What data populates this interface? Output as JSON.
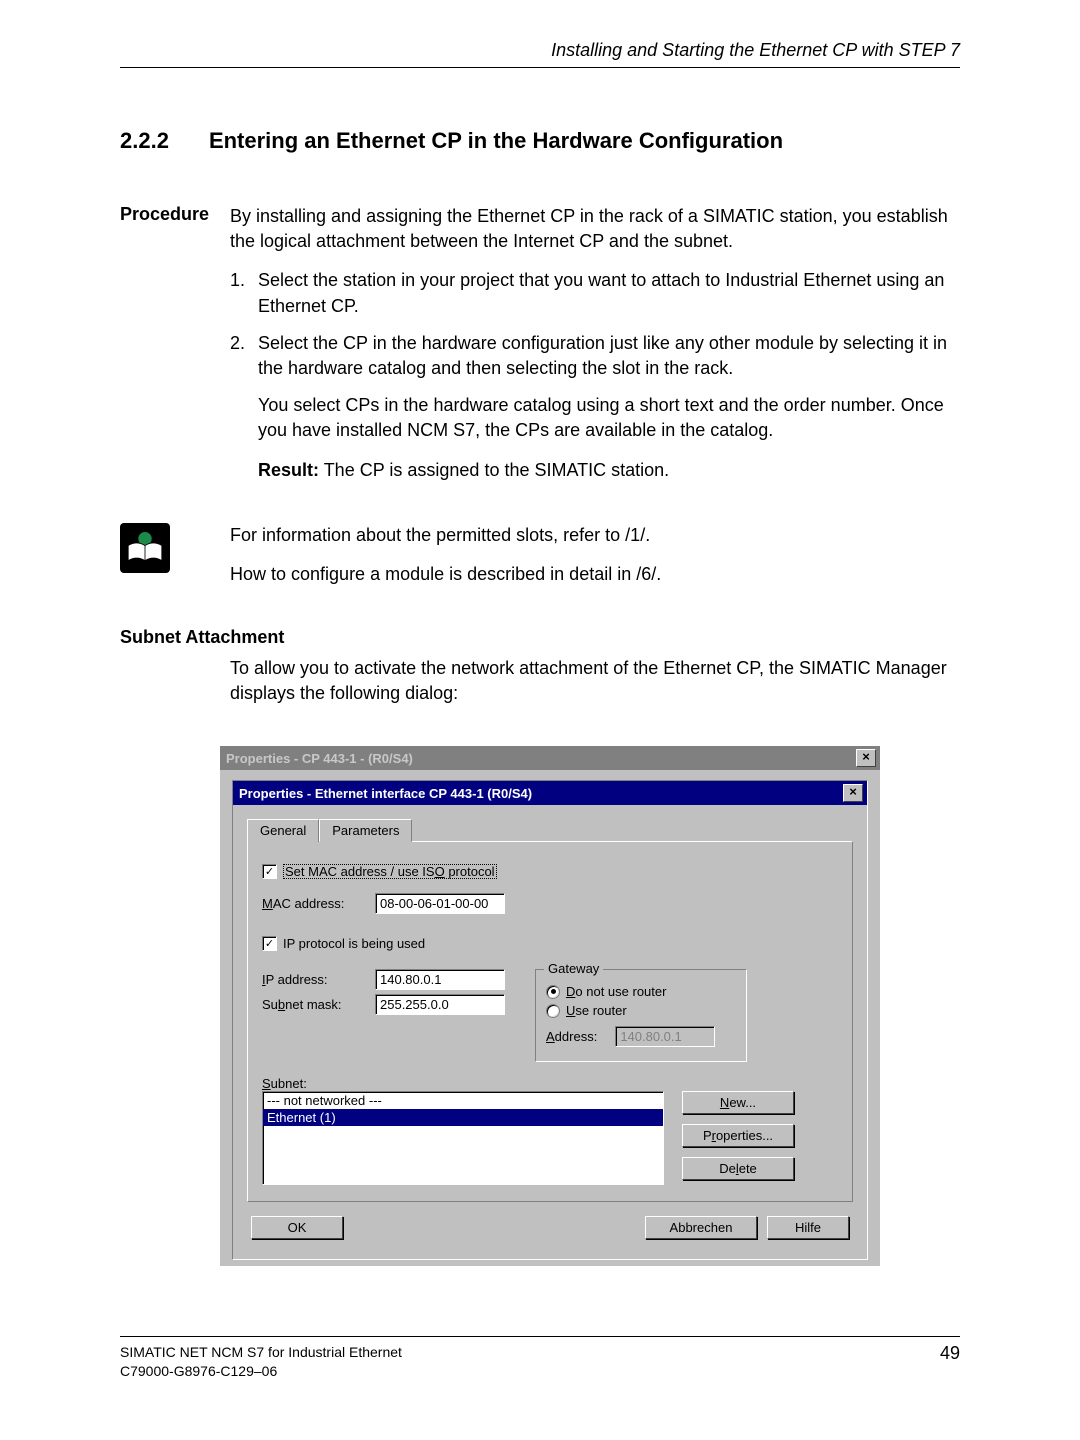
{
  "header": {
    "running": "Installing and Starting the Ethernet CP with STEP 7"
  },
  "section": {
    "number": "2.2.2",
    "title": "Entering an Ethernet CP in the Hardware Configuration"
  },
  "procedure": {
    "label": "Procedure",
    "intro": "By installing and assigning the Ethernet CP in the rack of a SIMATIC station, you establish the logical attachment between the Internet CP and the subnet.",
    "step1_num": "1.",
    "step1": "Select the station in your project that you want to attach to Industrial Ethernet using an Ethernet CP.",
    "step2_num": "2.",
    "step2": "Select the CP in the hardware configuration just like any other module by selecting it in the hardware catalog and then selecting the slot in the rack.",
    "step2b": "You select CPs in the hardware catalog using a short text and the order number. Once you have installed NCM S7, the CPs are available in the catalog.",
    "result_label": "Result:",
    "result_text": " The CP is assigned to the SIMATIC station.",
    "ref1": "For information about the permitted slots, refer to /1/.",
    "ref2": "How to configure a module is described in detail in /6/."
  },
  "subnet": {
    "label": "Subnet Attachment",
    "intro": "To allow you to activate the network attachment of the Ethernet CP, the SIMATIC Manager displays the following dialog:"
  },
  "dialog": {
    "outer_title": "Properties - CP 443-1 - (R0/S4)",
    "inner_title": "Properties - Ethernet interface  CP 443-1 (R0/S4)",
    "tabs": {
      "general": "General",
      "parameters": "Parameters"
    },
    "set_mac_pre": "Set MAC address / use IS",
    "set_mac_ul": "O",
    "set_mac_post": " protocol",
    "mac_label_ul": "M",
    "mac_label_rest": "AC address:",
    "mac_value": "08-00-06-01-00-00",
    "ip_used_text": "IP protocol is being used",
    "ip_label_ul": "I",
    "ip_label_rest": "P address:",
    "ip_value": "140.80.0.1",
    "subnetmask_pre": "Su",
    "subnetmask_ul": "b",
    "subnetmask_post": "net mask:",
    "subnetmask_value": "255.255.0.0",
    "gateway_title": "Gateway",
    "no_router_ul": "D",
    "no_router_rest": "o not use router",
    "use_router_ul": "U",
    "use_router_rest": "se router",
    "addr_label_ul": "A",
    "addr_label_rest": "ddress:",
    "addr_value": "140.80.0.1",
    "subnet_label_ul": "S",
    "subnet_label_rest": "ubnet:",
    "list_item_notnet": "--- not networked ---",
    "list_item_eth": "Ethernet (1)",
    "btn_new_ul": "N",
    "btn_new_rest": "ew...",
    "btn_props_pre": "P",
    "btn_props_ul": "r",
    "btn_props_rest": "operties...",
    "btn_delete_pre": "De",
    "btn_delete_ul": "l",
    "btn_delete_rest": "ete",
    "btn_ok": "OK",
    "btn_cancel": "Abbrechen",
    "btn_help": "Hilfe"
  },
  "footer": {
    "line1": "SIMATIC NET NCM S7 for Industrial Ethernet",
    "line2": "C79000-G8976-C129–06",
    "page": "49"
  }
}
